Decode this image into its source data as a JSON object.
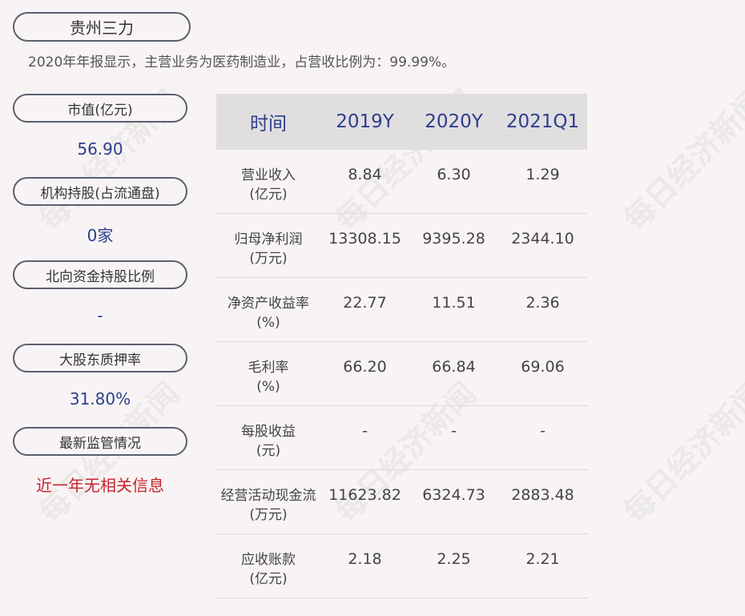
{
  "company": "贵州三力",
  "summary": "2020年年报显示，主营业务为医药制造业，占营收比例为：99.99%。",
  "metrics": [
    {
      "label": "市值(亿元)",
      "value": "56.90"
    },
    {
      "label": "机构持股(占流通盘)",
      "value": "0家"
    },
    {
      "label": "北向资金持股比例",
      "value": "-"
    },
    {
      "label": "大股东质押率",
      "value": "31.80%"
    },
    {
      "label": "最新监管情况",
      "value": "近一年无相关信息"
    }
  ],
  "table": {
    "headers": [
      "时间",
      "2019Y",
      "2020Y",
      "2021Q1"
    ],
    "rows": [
      {
        "label": "营业收入",
        "unit": "(亿元)",
        "values": [
          "8.84",
          "6.30",
          "1.29"
        ]
      },
      {
        "label": "归母净利润",
        "unit": "(万元)",
        "values": [
          "13308.15",
          "9395.28",
          "2344.10"
        ]
      },
      {
        "label": "净资产收益率",
        "unit": "(%)",
        "values": [
          "22.77",
          "11.51",
          "2.36"
        ]
      },
      {
        "label": "毛利率",
        "unit": "(%)",
        "values": [
          "66.20",
          "66.84",
          "69.06"
        ]
      },
      {
        "label": "每股收益",
        "unit": "(元)",
        "values": [
          "-",
          "-",
          "-"
        ]
      },
      {
        "label": "经营活动现金流",
        "unit": "(万元)",
        "values": [
          "11623.82",
          "6324.73",
          "2883.48"
        ]
      },
      {
        "label": "应收账款",
        "unit": "(亿元)",
        "values": [
          "2.18",
          "2.25",
          "2.21"
        ]
      }
    ]
  },
  "watermark": "每日经济新闻",
  "colors": {
    "accent": "#2b3f8c",
    "alert": "#c8232b",
    "header_bg": "#e1dee0"
  }
}
